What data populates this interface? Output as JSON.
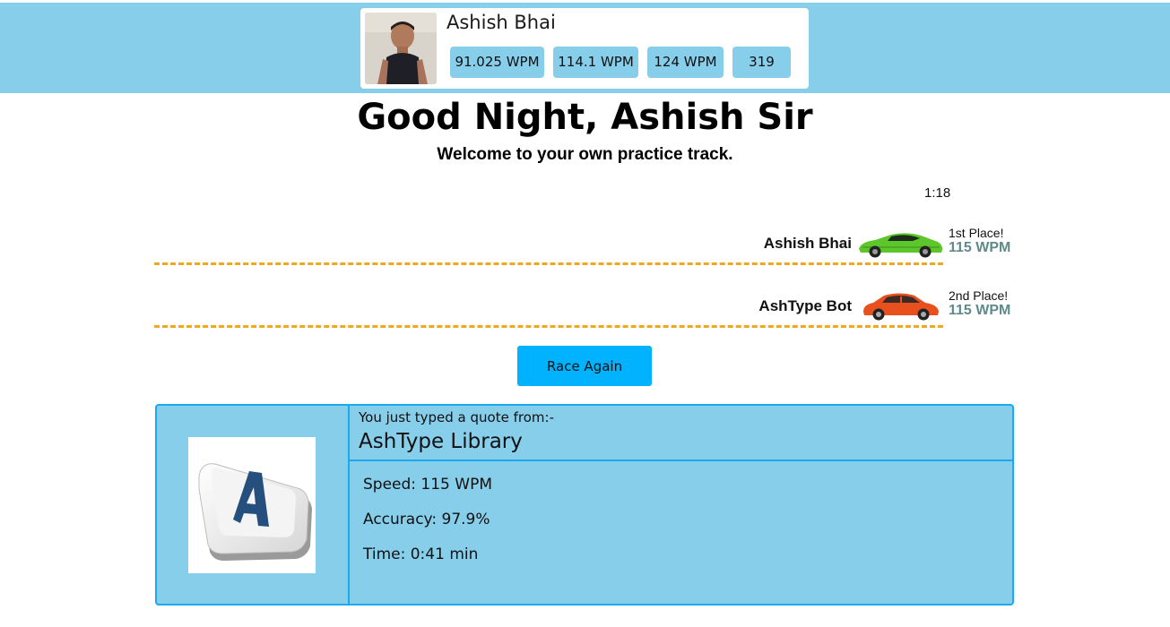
{
  "profile": {
    "name": "Ashish Bhai",
    "stats": [
      "91.025 WPM",
      "114.1 WPM",
      "124 WPM",
      "319"
    ]
  },
  "greeting": "Good Night, Ashish Sir",
  "subtitle": "Welcome to your own practice track.",
  "race": {
    "timer": "1:18",
    "racers": [
      {
        "name": "Ashish Bhai",
        "place": "1st Place!",
        "wpm": "115 WPM",
        "car_color": "#5cc62a",
        "car_icon": "green-sports-car-icon"
      },
      {
        "name": "AshType Bot",
        "place": "2nd Place!",
        "wpm": "115 WPM",
        "car_color": "#e8511e",
        "car_icon": "red-sedan-car-icon"
      }
    ],
    "race_again_label": "Race Again"
  },
  "result": {
    "quote_from_label": "You just typed a quote from:-",
    "library": "AshType Library",
    "speed": "Speed: 115 WPM",
    "accuracy": "Accuracy: 97.9%",
    "time": "Time: 0:41 min",
    "image_icon": "keyboard-key-a-icon"
  },
  "colors": {
    "header_bg": "#87ceeb",
    "track_dash": "#f0a81c",
    "button_bg": "#00b2ff",
    "result_border": "#19aaf0",
    "wpm_text": "#5f8a8b"
  }
}
